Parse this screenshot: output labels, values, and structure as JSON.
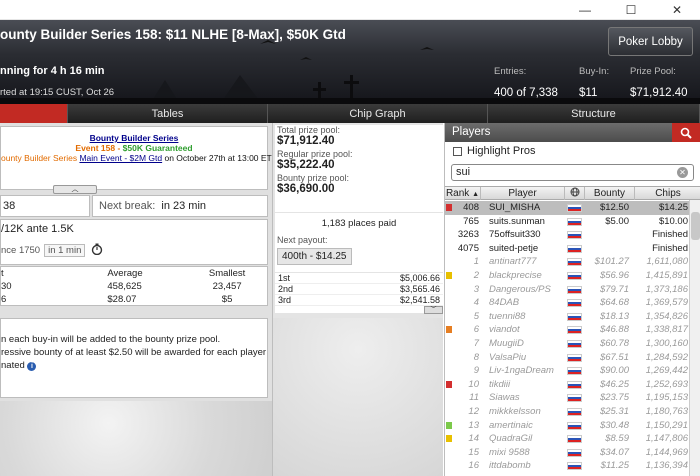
{
  "window": {
    "minimize": "—",
    "maximize": "☐",
    "close": "✕"
  },
  "header": {
    "title": "ounty Builder Series 158: $11 NLHE [8-Max], $50K Gtd",
    "running": "nning for 4 h 16 min",
    "started": "rted at 19:15 CUST, Oct 26",
    "lobby_button": "Poker Lobby",
    "entries_label": "Entries:",
    "entries_value": "400 of 7,338",
    "buyin_label": "Buy-In:",
    "buyin_value": "$11",
    "prize_label": "Prize Pool:",
    "prize_value": "$71,912.40"
  },
  "tabs": [
    "",
    "Tables",
    "Chip Graph",
    "Structure"
  ],
  "promo": {
    "line1": "Bounty Builder Series",
    "event_prefix": "Event 158 - ",
    "event_gtd": "$50K Guaranteed",
    "line3_prefix": "ounty Builder Series",
    "line3_link": "Main Event - $2M Gtd",
    "line3_suffix": " on October 27th at 13:00 ET!"
  },
  "level": {
    "value": "38",
    "next_break_label": "Next break:",
    "next_break_value": "in 23 min"
  },
  "blinds": {
    "current": "/12K ante 1.5K",
    "next_prefix": "nce 1750",
    "next_time": "in 1 min"
  },
  "stacks": {
    "headers": [
      "t",
      "Average",
      "Smallest"
    ],
    "row1": [
      "30",
      "458,625",
      "23,457"
    ],
    "row2": [
      "6",
      "$28.07",
      "$5"
    ]
  },
  "bounty_info": {
    "line1": "n each buy-in will be added to the bounty prize pool.",
    "line2": "ressive bounty of at least $2.50 will be awarded for each player",
    "line3": "nated"
  },
  "prize": {
    "total_label": "Total prize pool:",
    "total_value": "$71,912.40",
    "regular_label": "Regular prize pool:",
    "regular_value": "$35,222.40",
    "bounty_label": "Bounty prize pool:",
    "bounty_value": "$36,690.00",
    "places_paid": "1,183 places paid",
    "next_payout_label": "Next payout:",
    "next_payout_value": "400th - $14.25",
    "payouts": [
      {
        "place": "1st",
        "amount": "$5,006.66"
      },
      {
        "place": "2nd",
        "amount": "$3,565.46"
      },
      {
        "place": "3rd",
        "amount": "$2,541.58"
      }
    ]
  },
  "players": {
    "title": "Players",
    "highlight_label": "Highlight Pros",
    "search_value": "sui",
    "columns": {
      "rank": "Rank",
      "player": "Player",
      "bounty": "Bounty",
      "chips": "Chips"
    },
    "rows": [
      {
        "rank": "408",
        "player": "SUI_MISHA",
        "bounty": "$12.50",
        "chips": "$14.25",
        "marker": "#d32f2f",
        "style": "sel"
      },
      {
        "rank": "765",
        "player": "suits.sunman",
        "bounty": "$5.00",
        "chips": "$10.00",
        "marker": "",
        "style": ""
      },
      {
        "rank": "3263",
        "player": "75offsuit330",
        "bounty": "",
        "chips": "Finished",
        "marker": "",
        "style": ""
      },
      {
        "rank": "4075",
        "player": "suited-petje",
        "bounty": "",
        "chips": "Finished",
        "marker": "",
        "style": ""
      },
      {
        "rank": "1",
        "player": "antinart777",
        "bounty": "$101.27",
        "chips": "1,611,080",
        "marker": "",
        "style": "gray"
      },
      {
        "rank": "2",
        "player": "blackprecise",
        "bounty": "$56.96",
        "chips": "1,415,891",
        "marker": "#e8c000",
        "style": "gray"
      },
      {
        "rank": "3",
        "player": "Dangerous/PS",
        "bounty": "$79.71",
        "chips": "1,373,186",
        "marker": "",
        "style": "gray"
      },
      {
        "rank": "4",
        "player": "84DAB",
        "bounty": "$64.68",
        "chips": "1,369,579",
        "marker": "",
        "style": "gray"
      },
      {
        "rank": "5",
        "player": "tuenni88",
        "bounty": "$18.13",
        "chips": "1,354,826",
        "marker": "",
        "style": "gray"
      },
      {
        "rank": "6",
        "player": "viandot",
        "bounty": "$46.88",
        "chips": "1,338,817",
        "marker": "#e67e22",
        "style": "gray"
      },
      {
        "rank": "7",
        "player": "MuugiiD",
        "bounty": "$60.78",
        "chips": "1,300,160",
        "marker": "",
        "style": "gray"
      },
      {
        "rank": "8",
        "player": "ValsaPiu",
        "bounty": "$67.51",
        "chips": "1,284,592",
        "marker": "",
        "style": "gray"
      },
      {
        "rank": "9",
        "player": "Liv-1ngaDream",
        "bounty": "$90.00",
        "chips": "1,269,442",
        "marker": "",
        "style": "gray"
      },
      {
        "rank": "10",
        "player": "tikdiii",
        "bounty": "$46.25",
        "chips": "1,252,693",
        "marker": "#d32f2f",
        "style": "gray"
      },
      {
        "rank": "11",
        "player": "Siawas",
        "bounty": "$23.75",
        "chips": "1,195,153",
        "marker": "",
        "style": "gray"
      },
      {
        "rank": "12",
        "player": "mikkkelsson",
        "bounty": "$25.31",
        "chips": "1,180,763",
        "marker": "",
        "style": "gray"
      },
      {
        "rank": "13",
        "player": "amertinaic",
        "bounty": "$30.48",
        "chips": "1,150,291",
        "marker": "#7cc94a",
        "style": "gray"
      },
      {
        "rank": "14",
        "player": "QuadraGil",
        "bounty": "$8.59",
        "chips": "1,147,806",
        "marker": "#e8c000",
        "style": "gray"
      },
      {
        "rank": "15",
        "player": "mixi 9588",
        "bounty": "$34.07",
        "chips": "1,144,969",
        "marker": "",
        "style": "gray"
      },
      {
        "rank": "16",
        "player": "ittdabomb",
        "bounty": "$11.25",
        "chips": "1,136,394",
        "marker": "",
        "style": "gray"
      }
    ]
  }
}
